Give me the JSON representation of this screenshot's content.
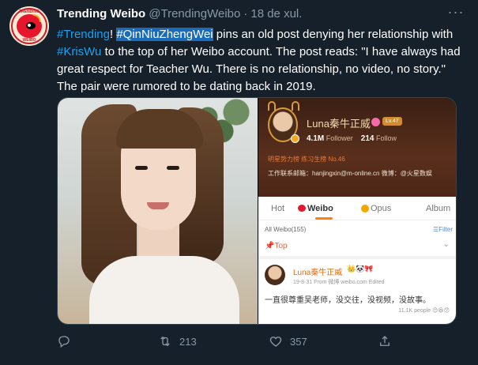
{
  "tweet": {
    "author_name": "Trending Weibo",
    "author_handle": "@TrendingWeibo",
    "separator": "·",
    "date": "18 de xul.",
    "avatar_text_top": "TRENDING",
    "avatar_text_bottom": "WEIBO",
    "text": {
      "part1": "#Trending",
      "part2": "! ",
      "part3": "#QinNiuZhengWei",
      "part4": " pins an old post denying her relationship with ",
      "part5": "#KrisWu",
      "part6": " to the top of her Weibo account. The post reads: \"I have always had great respect for Teacher Wu. There is no relationship, no video, no story.\" The pair were rumored to be dating back in 2019."
    },
    "actions": {
      "reply_count": "",
      "retweet_count": "213",
      "like_count": "357"
    }
  },
  "embedded_profile": {
    "name": "Luna秦牛正威",
    "level_badge": "Lv.47",
    "followers_value": "4.1M",
    "followers_label": "Follower",
    "following_value": "214",
    "following_label": "Follow",
    "rank": "明星势力榜 练习生榜 No.46",
    "info": "工作联系邮箱：hanjingxin@m-online.cn 微博：@火星数娱"
  },
  "embedded_weibo": {
    "tabs": [
      "Hot",
      "Weibo",
      "Opus",
      "Album"
    ],
    "all_weibo": "All Weibo(155)",
    "filter": "☰Filter",
    "top_label": "Top",
    "post_name": "Luna秦牛正威",
    "post_emoji": "👑🐼🎀",
    "post_meta": "19-8-31  From 微博 weibo.com  Edited",
    "post_text": "一直很尊重吴老师，没交往，没视频，没故事。",
    "likes": "11.1K people"
  },
  "colors": {
    "background": "#15202b",
    "link": "#1da1f2",
    "muted": "#8899a6",
    "highlight": "#1a6bb8",
    "weibo_orange": "#ff8200"
  }
}
